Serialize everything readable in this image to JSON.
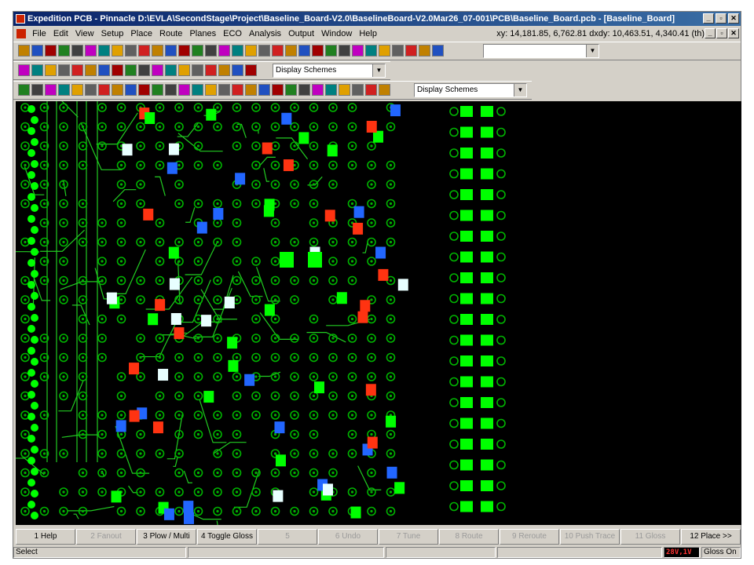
{
  "window": {
    "title": "Expedition PCB - Pinnacle  D:\\EVLA\\SecondStage\\Project\\Baseline_Board-V2.0\\BaselineBoard-V2.0Mar26_07-001\\PCB\\Baseline_Board.pcb - [Baseline_Board]"
  },
  "menu": {
    "items": [
      "File",
      "Edit",
      "View",
      "Setup",
      "Place",
      "Route",
      "Planes",
      "ECO",
      "Analysis",
      "Output",
      "Window",
      "Help"
    ],
    "coords": "xy: 14,181.85, 6,762.81  dxdy: 10,463.51, 4,340.41  (th)"
  },
  "toolbars": {
    "combo1_value": "",
    "combo2_value": "Display Schemes",
    "combo3_value": "Display Schemes"
  },
  "fkeys": [
    {
      "label": "1 Help",
      "enabled": true
    },
    {
      "label": "2 Fanout",
      "enabled": false
    },
    {
      "label": "3 Plow / Multi",
      "enabled": true
    },
    {
      "label": "4 Toggle Gloss",
      "enabled": true
    },
    {
      "label": "5",
      "enabled": false
    },
    {
      "label": "6 Undo",
      "enabled": false
    },
    {
      "label": "7 Tune",
      "enabled": false
    },
    {
      "label": "8 Route",
      "enabled": false
    },
    {
      "label": "9 Reroute",
      "enabled": false
    },
    {
      "label": "10 Push Trace",
      "enabled": false
    },
    {
      "label": "11 Gloss",
      "enabled": false
    },
    {
      "label": "12 Place >>",
      "enabled": true
    }
  ],
  "status": {
    "mode": "Select",
    "layer_badge": "28V,1V",
    "gloss": "Gloss On"
  },
  "colors": {
    "canvas_bg": "#000000",
    "via_green": "#00b400",
    "pad_green": "#00ff00",
    "pad_blue": "#2266ff",
    "pad_red": "#ff3311",
    "pad_white": "#e8ffff",
    "trace_green": "#22cc22"
  },
  "icons": [
    "open-icon",
    "new-icon",
    "save-icon",
    "exit-icon",
    "find-icon",
    "binoculars-icon",
    "undo-icon",
    "redo-icon",
    "cut-icon",
    "place-icon",
    "display-icon",
    "prev-icon",
    "next-icon",
    "route-icon",
    "layer-icon",
    "gloss-icon",
    "properties-icon",
    "drc-icon",
    "warning-icon",
    "check-icon",
    "copy-icon",
    "cancel-icon",
    "grid-icon",
    "library-icon",
    "netlist-icon"
  ]
}
